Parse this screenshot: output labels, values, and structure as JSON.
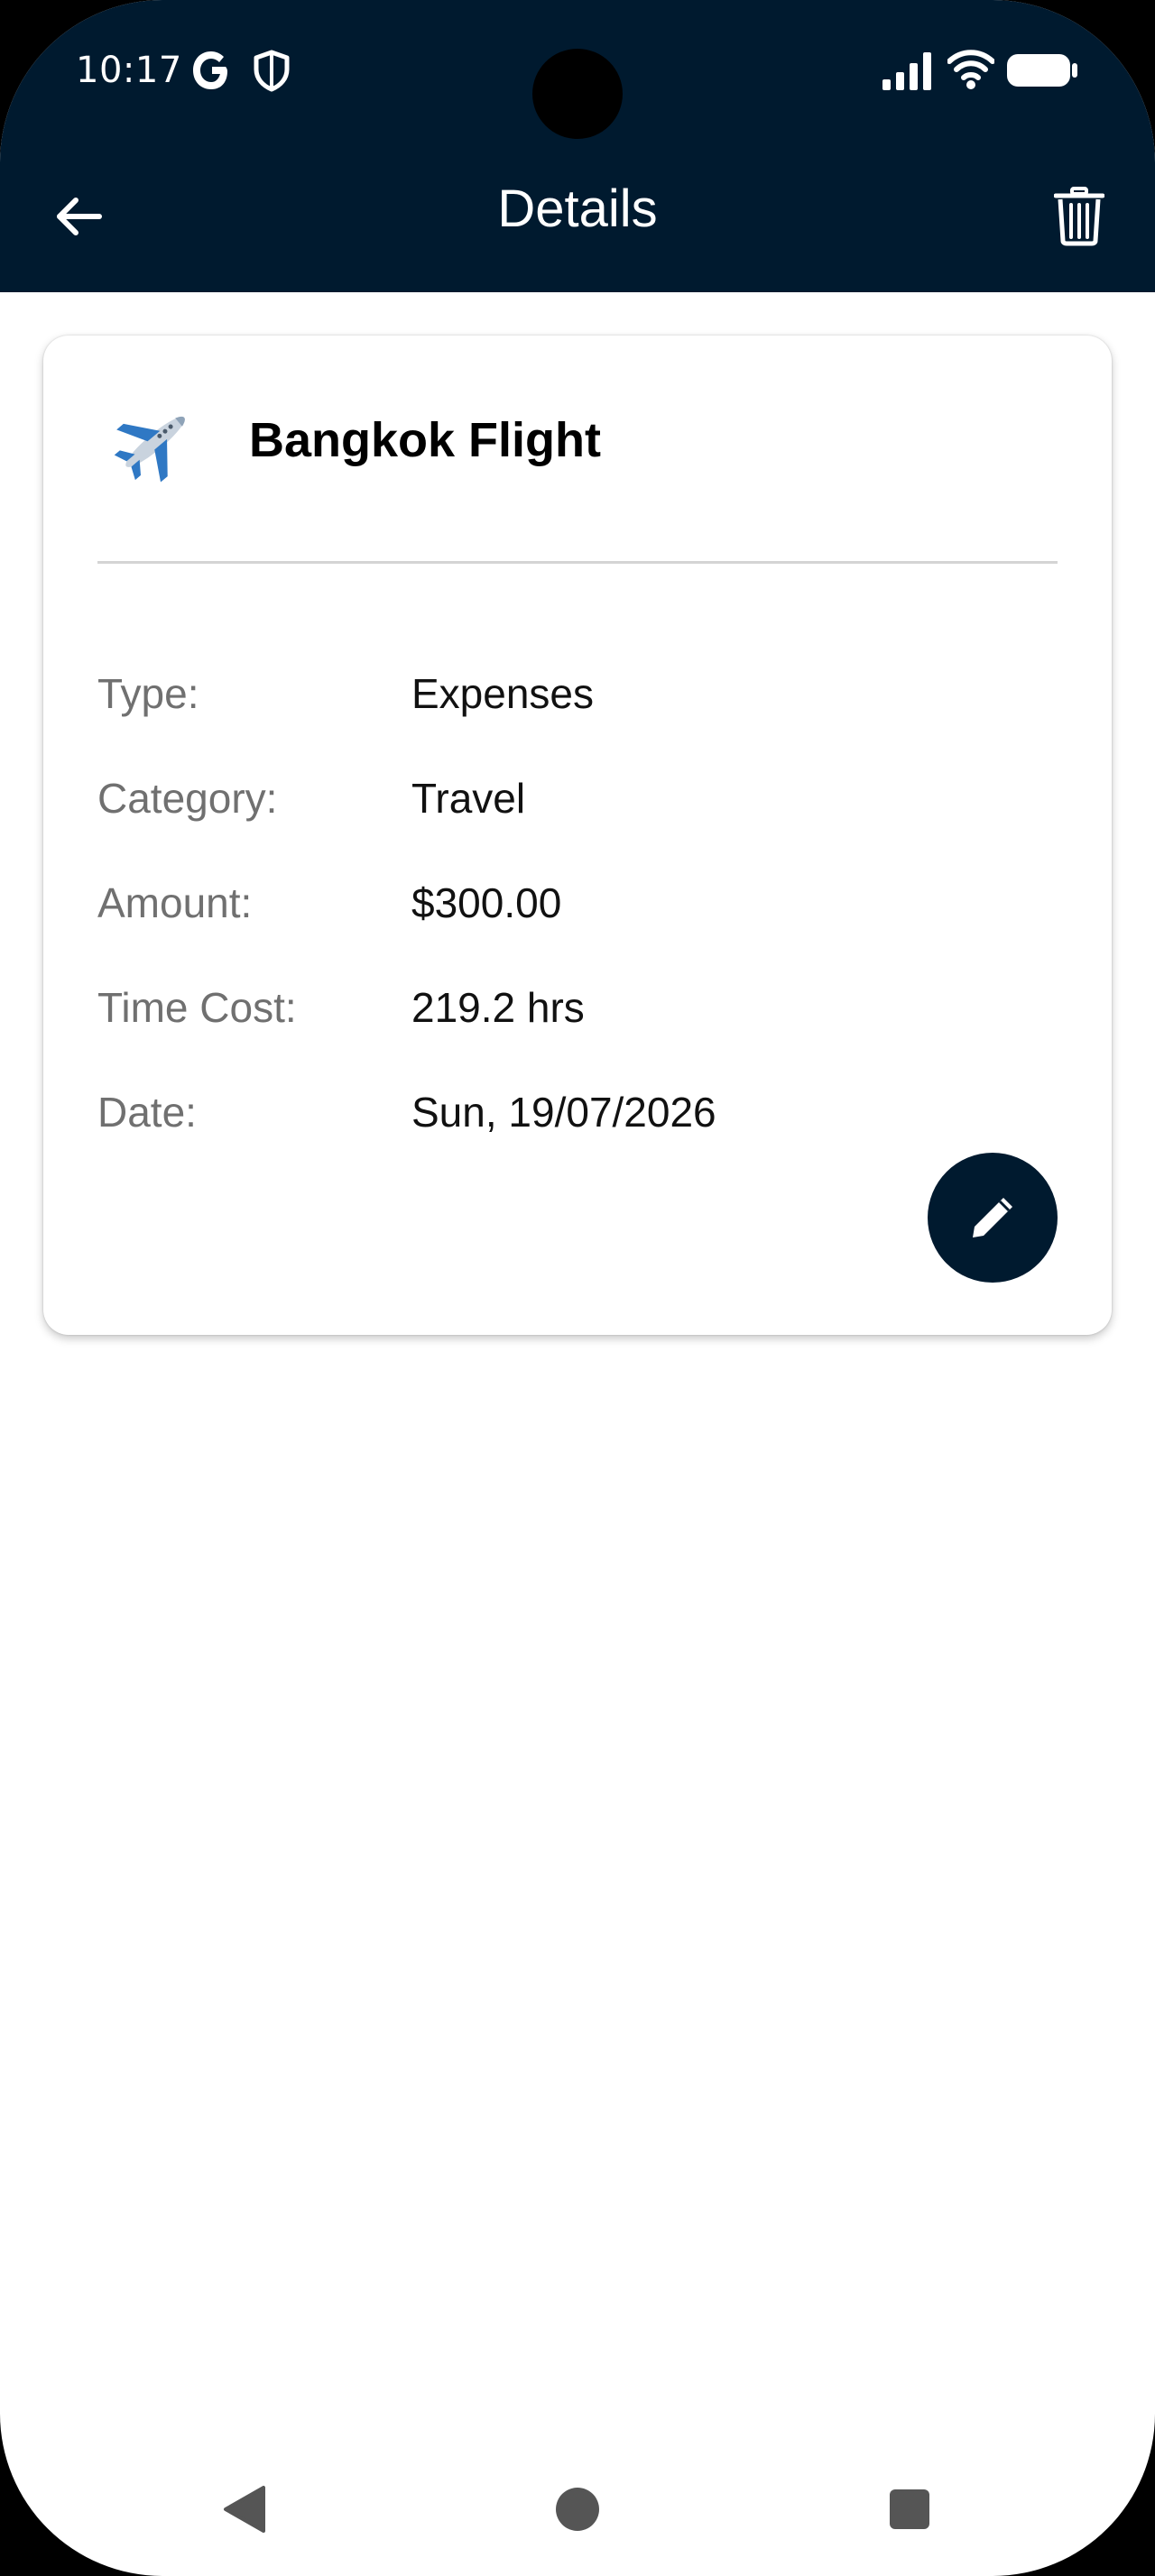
{
  "status_bar": {
    "time": "10:17",
    "icons": [
      "google-icon",
      "shield-icon",
      "signal-icon",
      "wifi-icon",
      "battery-icon"
    ]
  },
  "appbar": {
    "title": "Details",
    "back_icon": "arrow-left-icon",
    "delete_icon": "trash-icon"
  },
  "card": {
    "icon": "airplane-icon",
    "title": "Bangkok Flight",
    "rows": [
      {
        "label": "Type:",
        "value": "Expenses"
      },
      {
        "label": "Category:",
        "value": "Travel"
      },
      {
        "label": "Amount:",
        "value": "$300.00"
      },
      {
        "label": "Time Cost:",
        "value": "219.2 hrs"
      },
      {
        "label": "Date:",
        "value": "Sun, 19/07/2026"
      }
    ],
    "edit_icon": "pencil-icon"
  },
  "nav_bar": {
    "icons": [
      "nav-back-icon",
      "nav-home-icon",
      "nav-recents-icon"
    ]
  },
  "colors": {
    "primary_dark": "#001a2f",
    "background": "#ffffff",
    "label_gray": "#707070",
    "divider": "#d4d4d4"
  }
}
